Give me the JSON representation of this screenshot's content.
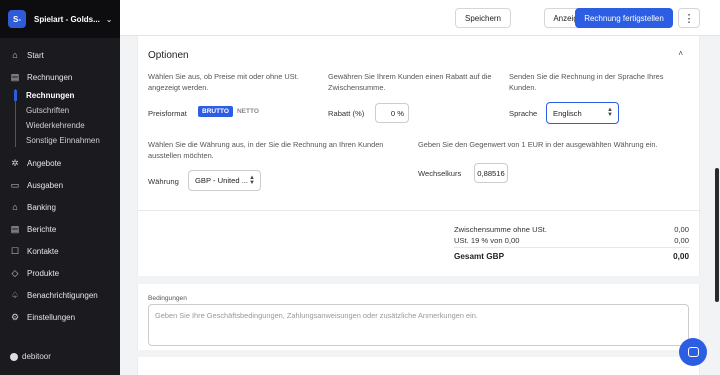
{
  "sidebar": {
    "company_initials": "S-",
    "company_name": "Spielart - Golds...",
    "items": [
      {
        "label": "Start"
      },
      {
        "label": "Rechnungen"
      },
      {
        "label": "Angebote"
      },
      {
        "label": "Ausgaben"
      },
      {
        "label": "Banking"
      },
      {
        "label": "Berichte"
      },
      {
        "label": "Kontakte"
      },
      {
        "label": "Produkte"
      },
      {
        "label": "Benachrichtigungen"
      },
      {
        "label": "Einstellungen"
      }
    ],
    "subitems": [
      {
        "label": "Rechnungen"
      },
      {
        "label": "Gutschriften"
      },
      {
        "label": "Wiederkehrende"
      },
      {
        "label": "Sonstige Einnahmen"
      }
    ],
    "brand": "debitoor"
  },
  "toolbar": {
    "save_label": "Speichern",
    "show_label": "Anzeigen",
    "finalize_label": "Rechnung fertigstellen",
    "more_label": "⋮"
  },
  "options": {
    "title": "Optionen",
    "price_desc": "Wählen Sie aus, ob Preise mit oder ohne USt. angezeigt werden.",
    "price_label": "Preisformat",
    "price_on": "BRUTTO",
    "price_off": "NETTO",
    "discount_desc": "Gewähren Sie Ihrem Kunden einen Rabatt auf die Zwischensumme.",
    "discount_label": "Rabatt (%)",
    "discount_value": "0 %",
    "language_desc": "Senden Sie die Rechnung in der Sprache Ihres Kunden.",
    "language_label": "Sprache",
    "language_value": "Englisch",
    "currency_desc": "Wählen Sie die Währung aus, in der Sie die Rechnung an Ihren Kunden ausstellen möchten.",
    "currency_label": "Währung",
    "currency_value": "GBP - United ...",
    "rate_desc": "Geben Sie den Gegenwert von 1 EUR in der ausgewählten Währung ein.",
    "rate_label": "Wechselkurs",
    "rate_value": "0,88516"
  },
  "totals": {
    "subtotal_label": "Zwischensumme ohne USt.",
    "subtotal_value": "0,00",
    "vat_label": "USt. 19 % von 0,00",
    "vat_value": "0,00",
    "total_label": "Gesamt GBP",
    "total_value": "0,00"
  },
  "conditions": {
    "label": "Bedingungen",
    "placeholder": "Geben Sie Ihre Geschäftsbedingungen, Zahlungsanweisungen oder zusätzliche Anmerkungen ein."
  },
  "colors": {
    "accent": "#2c5ee4",
    "sidebar_bg": "#1b1b1f"
  }
}
